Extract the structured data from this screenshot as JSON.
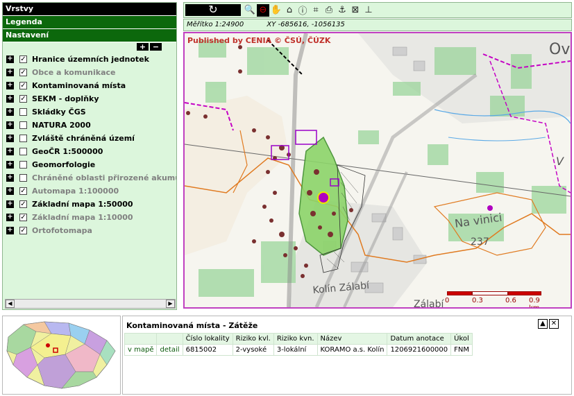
{
  "left_panel": {
    "sections": [
      "Vrstvy",
      "Legenda",
      "Nastavení"
    ],
    "expand_all": "+",
    "collapse_all": "−",
    "layers": [
      {
        "name": "Hranice územních jednotek",
        "checked": true,
        "dim": false
      },
      {
        "name": "Obce a komunikace",
        "checked": true,
        "dim": true
      },
      {
        "name": "Kontaminovaná místa",
        "checked": true,
        "dim": false
      },
      {
        "name": "SEKM - doplňky",
        "checked": true,
        "dim": false
      },
      {
        "name": "Skládky ČGS",
        "checked": false,
        "dim": false
      },
      {
        "name": "NATURA 2000",
        "checked": false,
        "dim": false
      },
      {
        "name": "Zvláště chráněná území",
        "checked": false,
        "dim": false
      },
      {
        "name": "GeoČR 1:500000",
        "checked": false,
        "dim": false
      },
      {
        "name": "Geomorfologie",
        "checked": false,
        "dim": false
      },
      {
        "name": "Chráněné oblasti přirozené akumulac",
        "checked": false,
        "dim": true
      },
      {
        "name": "Automapa 1:100000",
        "checked": true,
        "dim": true
      },
      {
        "name": "Základní mapa 1:50000",
        "checked": true,
        "dim": false
      },
      {
        "name": "Základní mapa 1:10000",
        "checked": true,
        "dim": true
      },
      {
        "name": "Ortofotomapa",
        "checked": true,
        "dim": true
      }
    ]
  },
  "toolbar": {
    "refresh_icon": "refresh-icon",
    "tools": [
      "zoom-in-icon",
      "zoom-out-icon",
      "pan-hand-icon",
      "home-icon",
      "info-icon",
      "measure-icon",
      "print-icon",
      "anchor-icon",
      "zoom-extent-icon",
      "stamp-icon"
    ],
    "active_tool": "zoom-out-icon"
  },
  "status": {
    "scale": "Měřítko 1:24900",
    "coords": "XY -685616, -1056135"
  },
  "map": {
    "copyright": "Published by CENIA   © ČSÚ, ČÚZK",
    "labels": [
      "Na vinici",
      "237",
      "Kolín Zálabí",
      "Zálabí",
      "Ov",
      "V"
    ],
    "scale_labels": [
      "0",
      "0.3",
      "0.6",
      "0.9 km"
    ]
  },
  "results": {
    "title": "Kontaminovaná místa - Zátěže",
    "columns": [
      "",
      "",
      "Číslo lokality",
      "Riziko kvl.",
      "Riziko kvn.",
      "Název",
      "Datum anotace",
      "Úkol"
    ],
    "rows": [
      [
        "v mapě",
        "detail",
        "6815002",
        "2-vysoké",
        "3-lokální",
        "KORAMO a.s. Kolín",
        "1206921600000",
        "FNM"
      ]
    ]
  },
  "colors": {
    "panel_green": "#dcf6dc",
    "header_green": "#0c680c",
    "border_magenta": "#c040c0",
    "copyright_red": "#c0302a"
  }
}
